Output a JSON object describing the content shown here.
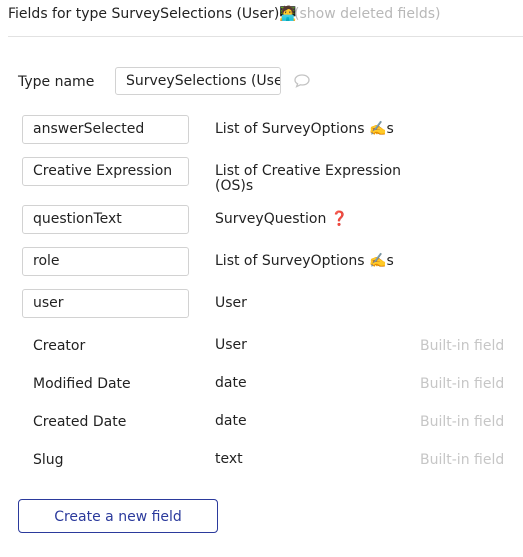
{
  "header": {
    "title": "Fields for type SurveySelections (User)🧑‍💻",
    "show_deleted_link": "(show deleted fields)"
  },
  "type_name": {
    "label": "Type name",
    "value": "SurveySelections (User)"
  },
  "custom_fields": [
    {
      "name": "answerSelected",
      "type": "List of SurveyOptions ✍️s"
    },
    {
      "name": "Creative Expression",
      "type": "List of Creative Expression (OS)s"
    },
    {
      "name": "questionText",
      "type": "SurveyQuestion ❓"
    },
    {
      "name": "role",
      "type": "List of SurveyOptions ✍️s"
    },
    {
      "name": "user",
      "type": "User"
    }
  ],
  "builtin_fields": [
    {
      "name": "Creator",
      "type": "User",
      "tag": "Built-in field"
    },
    {
      "name": "Modified Date",
      "type": "date",
      "tag": "Built-in field"
    },
    {
      "name": "Created Date",
      "type": "date",
      "tag": "Built-in field"
    },
    {
      "name": "Slug",
      "type": "text",
      "tag": "Built-in field"
    }
  ],
  "create_button": "Create a new field",
  "icons": {
    "comment": "speech-bubble-icon"
  }
}
